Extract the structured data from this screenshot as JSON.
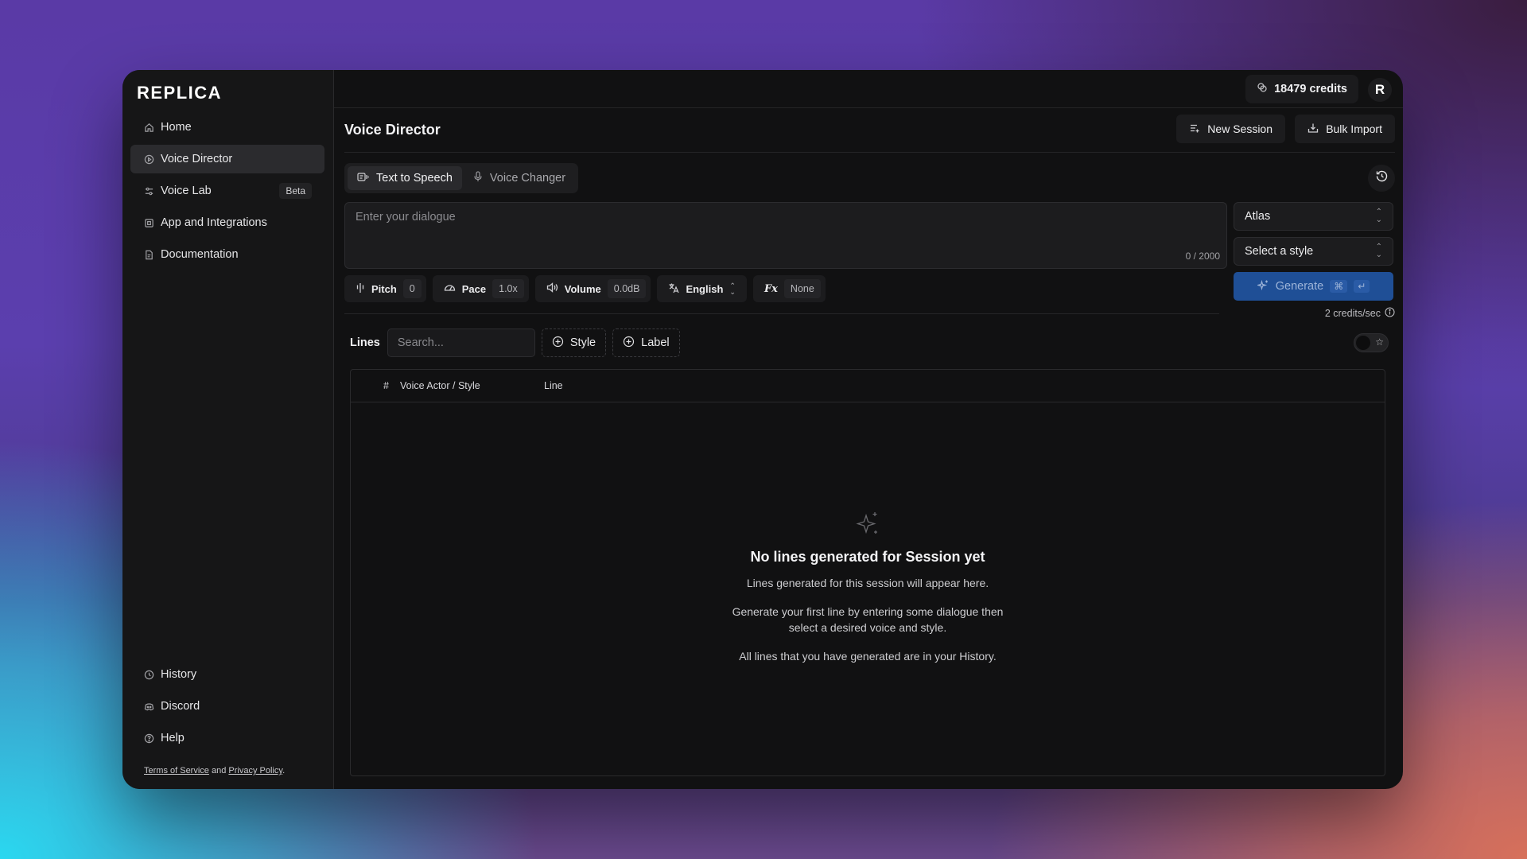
{
  "app": {
    "logo_text": "REPLICA"
  },
  "sidebar": {
    "items": [
      {
        "label": "Home",
        "icon": "home-icon"
      },
      {
        "label": "Voice Director",
        "icon": "play-circle-icon",
        "active": true
      },
      {
        "label": "Voice Lab",
        "icon": "sliders-icon",
        "badge": "Beta"
      },
      {
        "label": "App and Integrations",
        "icon": "grid-icon"
      },
      {
        "label": "Documentation",
        "icon": "doc-icon"
      }
    ],
    "bottom_items": [
      {
        "label": "History",
        "icon": "clock-icon"
      },
      {
        "label": "Discord",
        "icon": "discord-icon"
      },
      {
        "label": "Help",
        "icon": "help-icon"
      }
    ],
    "legal": {
      "terms": "Terms of Service",
      "and": "and",
      "privacy": "Privacy Policy",
      "suffix": "."
    }
  },
  "topbar": {
    "credits": "18479 credits",
    "avatar": "R"
  },
  "header": {
    "title": "Voice Director",
    "new_session": "New Session",
    "bulk_import": "Bulk Import"
  },
  "tabs": {
    "tts": "Text to Speech",
    "vc": "Voice Changer"
  },
  "dialogue": {
    "placeholder": "Enter your dialogue",
    "counter": "0 / 2000"
  },
  "voice_select": {
    "value": "Atlas"
  },
  "style_select": {
    "value": "Select a style"
  },
  "controls": {
    "pitch_label": "Pitch",
    "pitch_value": "0",
    "pace_label": "Pace",
    "pace_value": "1.0x",
    "volume_label": "Volume",
    "volume_value": "0.0dB",
    "language_value": "English",
    "fx_label": "Fx",
    "fx_value": "None"
  },
  "generate": {
    "label": "Generate",
    "kbd1": "⌘",
    "kbd2": "↵",
    "credits_rate": "2 credits/sec"
  },
  "lines": {
    "label": "Lines",
    "search_placeholder": "Search...",
    "style_filter": "Style",
    "label_filter": "Label",
    "columns": [
      "#",
      "Voice Actor / Style",
      "Line"
    ]
  },
  "empty_state": {
    "title": "No lines generated for Session yet",
    "p1": "Lines generated for this session will appear here.",
    "p2a": "Generate your first line by entering some dialogue then",
    "p2b": "select a desired voice and style.",
    "p3": "All lines that you have generated are in your History."
  },
  "colors": {
    "accent": "#1f4f96",
    "window_bg": "#111112",
    "sidebar_bg": "#161617"
  }
}
